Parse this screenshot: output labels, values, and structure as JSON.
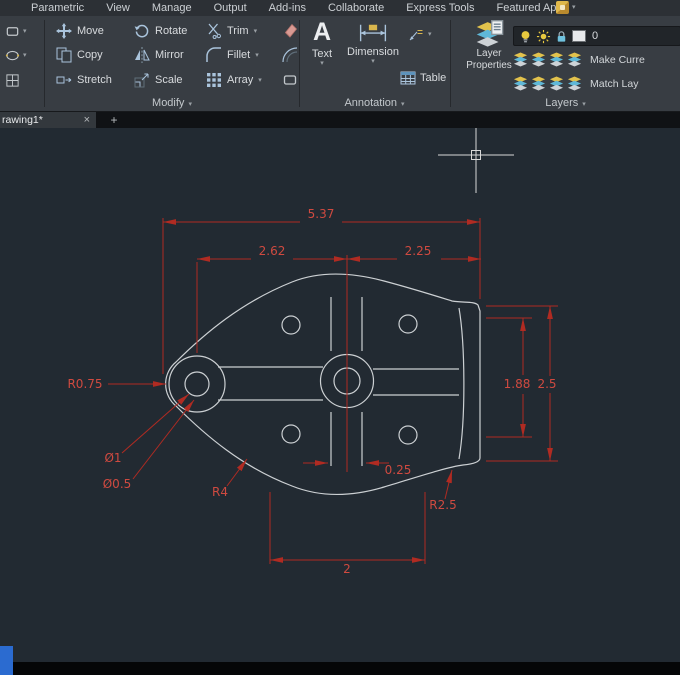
{
  "menubar": {
    "items": [
      "Parametric",
      "View",
      "Manage",
      "Output",
      "Add-ins",
      "Collaborate",
      "Express Tools",
      "Featured Apps"
    ]
  },
  "ribbon": {
    "modify": {
      "label": "Modify",
      "rows": [
        [
          "Move",
          "Rotate",
          "Trim"
        ],
        [
          "Copy",
          "Mirror",
          "Fillet"
        ],
        [
          "Stretch",
          "Scale",
          "Array"
        ]
      ]
    },
    "annotation": {
      "label": "Annotation",
      "text_btn": "Text",
      "dimension_btn": "Dimension",
      "table_btn": "Table"
    },
    "layers": {
      "label": "Layers",
      "properties_line1": "Layer",
      "properties_line2": "Properties",
      "current_layer": "0",
      "make_current": "Make Curre",
      "match_layer": "Match Lay"
    }
  },
  "tabbar": {
    "drawing_tab": "rawing1*"
  },
  "icons": {
    "dropdown": "▾",
    "close": "×",
    "add": "+",
    "text_glyph": "A"
  },
  "dimensions": {
    "overall_width": "5.37",
    "left_span": "2.62",
    "right_span": "2.25",
    "left_radius": "R0.75",
    "hole_diameter": "Ø1",
    "small_hole_diameter": "Ø0.5",
    "fillet_radius": "R4",
    "slot_offset": "0.25",
    "right_fillet_radius": "R2.5",
    "hole_spacing": "1.88",
    "right_height": "2.5",
    "bottom_span": "2"
  },
  "colors": {
    "dimension_red": "#b02b22",
    "dimension_text_red": "#cf4a40",
    "geometry_line": "#ccd0d3",
    "canvas_background": "#222a32"
  }
}
